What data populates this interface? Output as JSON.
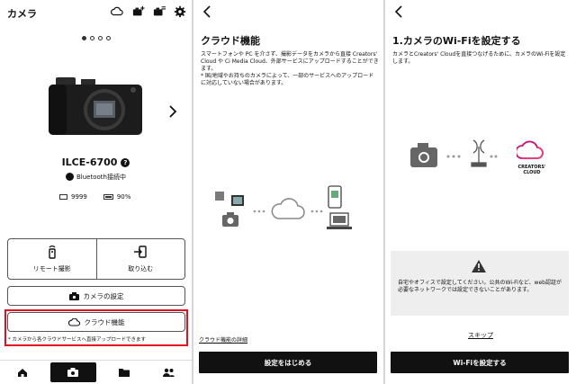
{
  "screen_camera": {
    "title": "カメラ",
    "carousel_dots": 4,
    "model": "ILCE-6700",
    "model_help": "?",
    "bluetooth_status": "Bluetooth接続中",
    "remaining_shots": "9999",
    "battery": "90%",
    "remote_label": "リモート撮影",
    "import_label": "取り込む",
    "camera_settings_label": "カメラの設定",
    "cloud_label": "クラウド機能",
    "cloud_note": "* カメラから各クラウドサービスへ直接アップロードできます",
    "highlight_color": "#e20f1e"
  },
  "screen_cloud": {
    "title": "クラウド機能",
    "description": "スマートフォンや PC を介さず、撮影データをカメラから直接 Creators' Cloud や Ci Media Cloud、外部サービスにアップロードすることができます。",
    "note": "* 国/地域やお持ちのカメラによって、一部のサービスへのアップロードに対応していない場合があります。",
    "details_link": "クラウド機能の詳細",
    "start_button": "設定をはじめる"
  },
  "screen_wifi": {
    "title": "1.カメラのWi-Fiを設定する",
    "description": "カメラとCreators' Cloudを直接つなげるために、カメラのWi-Fiを設定します。",
    "brand_line1": "CREATORS'",
    "brand_line2": "CLOUD",
    "warning": "自宅やオフィスで設定してください。公共のWi-Fiなど、web認証が必要なネットワークでは設定できないことがあります。",
    "skip": "スキップ",
    "setup_button": "Wi-Fiを設定する"
  }
}
